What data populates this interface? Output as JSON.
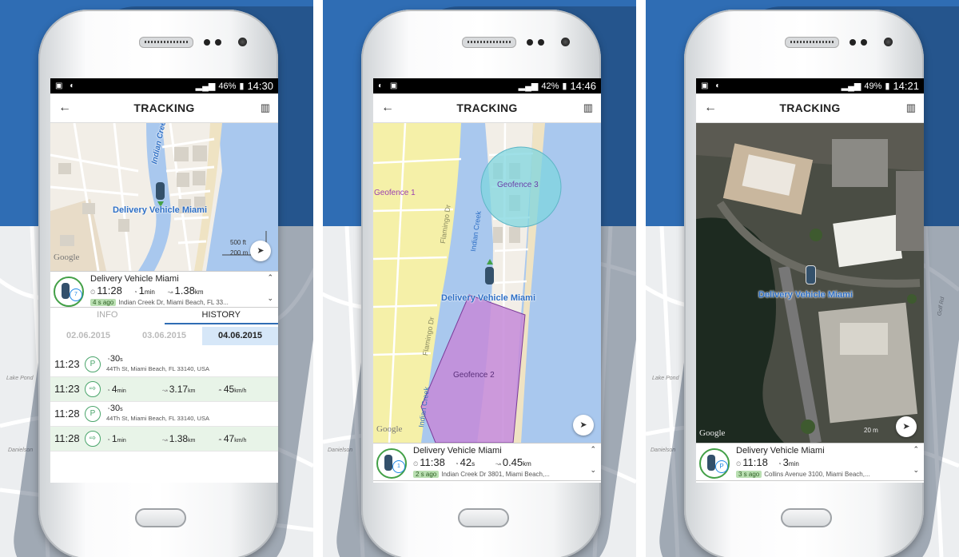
{
  "phones": [
    {
      "status": {
        "left_icons": "▣ ◐",
        "battery": "46%",
        "time": "14:30"
      },
      "header": {
        "title": "TRACKING",
        "back": "←",
        "map_icon": "🗺"
      },
      "map": {
        "vehicle_label": "Delivery Vehicle Miami",
        "google": "Google",
        "creek_label": "Indian Creek",
        "scale_ft": "500 ft",
        "scale_m": "200 m"
      },
      "card": {
        "name": "Delivery Vehicle Miami",
        "time": "11:28",
        "duration_value": "1",
        "duration_unit": "min",
        "distance_value": "1.38",
        "distance_unit": "km",
        "speed": "7",
        "ago": "4 s ago",
        "address": "Indian Creek Dr, Miami Beach, FL 33..."
      },
      "tabs": {
        "info": "INFO",
        "history": "HISTORY"
      },
      "dates": [
        "02.06.2015",
        "03.06.2015",
        "04.06.2015"
      ],
      "history": [
        {
          "time": "11:23",
          "type": "parking",
          "icon": "P",
          "duration_value": "30",
          "duration_unit": "s",
          "address": "44Th St, Miami Beach, FL 33140, USA"
        },
        {
          "time": "11:23",
          "type": "drive",
          "icon": "⇨",
          "duration_value": "4",
          "duration_unit": "min",
          "distance_value": "3.17",
          "distance_unit": "km",
          "speed_value": "45",
          "speed_unit": "km/h"
        },
        {
          "time": "11:28",
          "type": "parking",
          "icon": "P",
          "duration_value": "30",
          "duration_unit": "s",
          "address": "44Th St, Miami Beach, FL 33140, USA"
        },
        {
          "time": "11:28",
          "type": "drive",
          "icon": "⇨",
          "duration_value": "1",
          "duration_unit": "min",
          "distance_value": "1.38",
          "distance_unit": "km",
          "speed_value": "47",
          "speed_unit": "km/h"
        }
      ]
    },
    {
      "status": {
        "left_icons": "◐ ▣",
        "battery": "42%",
        "time": "14:46"
      },
      "header": {
        "title": "TRACKING",
        "back": "←",
        "map_icon": "🗺"
      },
      "map": {
        "vehicle_label": "Delivery Vehicle Miami",
        "google": "Google",
        "geofence1": "Geofence 1",
        "geofence2": "Geofence 2",
        "geofence3": "Geofence 3",
        "street1": "Flamingo Dr",
        "street2": "Indian Creek",
        "street3": "Flamingo Dr",
        "street4": "Indian Creek"
      },
      "card": {
        "name": "Delivery Vehicle Miami",
        "time": "11:38",
        "duration_value": "42",
        "duration_unit": "s",
        "distance_value": "0.45",
        "distance_unit": "km",
        "speed": "1",
        "ago": "2 s ago",
        "address": "Indian Creek Dr 3801, Miami Beach,..."
      }
    },
    {
      "status": {
        "left_icons": "▣ ◐",
        "battery": "49%",
        "time": "14:21"
      },
      "header": {
        "title": "TRACKING",
        "back": "←",
        "map_icon": "🗺"
      },
      "map": {
        "vehicle_label": "Delivery Vehicle Miami",
        "google": "Google",
        "scale_m": "20 m"
      },
      "card": {
        "name": "Delivery Vehicle Miami",
        "time": "11:18",
        "duration_value": "3",
        "duration_unit": "min",
        "ago": "3 s ago",
        "address": "Collins Avenue 3100, Miami Beach,..."
      }
    }
  ],
  "background_labels": [
    "Danielson",
    "Lake Pond",
    "Golf Rd",
    "Wangah Rd"
  ],
  "colors": {
    "blue_bg": "#2f6db4",
    "accent_green": "#43a047",
    "accent_blue": "#1e88e5",
    "geofence_purple": "#c58ad8",
    "geofence_cyan": "#7fd6df"
  }
}
